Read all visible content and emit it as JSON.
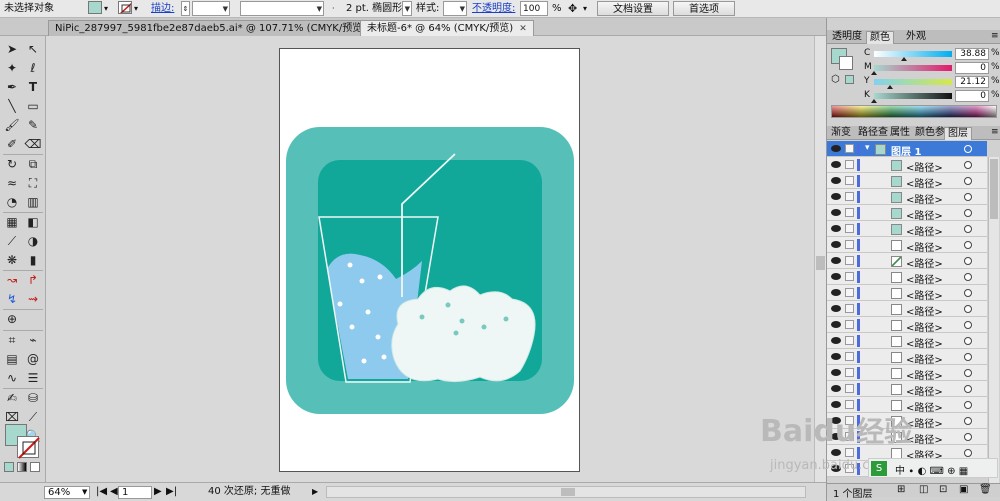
{
  "control_bar": {
    "selection_label": "未选择对象",
    "stroke_label": "描边:",
    "brush_label": "2 pt. 椭圆形",
    "style_label": "样式:",
    "opacity_label": "不透明度:",
    "opacity_value": "100",
    "opacity_unit": "%",
    "doc_setup_button": "文档设置",
    "preferences_button": "首选项",
    "fill_color": "#a6d8ce"
  },
  "tabs": [
    {
      "label": "NiPic_287997_5981fbe2e87daeb5.ai* @ 107.71% (CMYK/预览)",
      "close": "✕"
    },
    {
      "label": "未标题-6* @ 64% (CMYK/预览)",
      "close": "✕"
    }
  ],
  "status_bar": {
    "zoom": "64%",
    "artboard": "1",
    "history": "40 次还原; 无重做"
  },
  "color_panel": {
    "tabs": [
      "透明度",
      "颜色",
      "外观"
    ],
    "channels": [
      {
        "name": "C",
        "value": "38.88",
        "unit": "%",
        "level": 0.3888
      },
      {
        "name": "M",
        "value": "0",
        "unit": "%",
        "level": 0
      },
      {
        "name": "Y",
        "value": "21.12",
        "unit": "%",
        "level": 0.2112
      },
      {
        "name": "K",
        "value": "0",
        "unit": "%",
        "level": 0
      }
    ]
  },
  "layers_panel": {
    "tabs": [
      "渐变",
      "路径查",
      "属性",
      "颜色参",
      "图层"
    ],
    "layer_name": "图层 1",
    "items": [
      "<路径>",
      "<路径>",
      "<路径>",
      "<路径>",
      "<路径>",
      "<路径>",
      "<路径>",
      "<路径>",
      "<路径>",
      "<路径>",
      "<路径>",
      "<路径>",
      "<路径>",
      "<路径>",
      "<路径>",
      "<路径>",
      "<路径>",
      "<路径>",
      "<路径>",
      "<路径>"
    ],
    "footer_label": "1 个图层"
  },
  "watermark": {
    "brand": "Baidu",
    "word": "经验",
    "url": "jingyan.baidu.com"
  },
  "artwork_colors": {
    "outer": "#56bfb8",
    "inner": "#11a89a",
    "liquid": "#8ec9ee",
    "cloud": "#eef7f5",
    "dots": "#79c9bf"
  }
}
